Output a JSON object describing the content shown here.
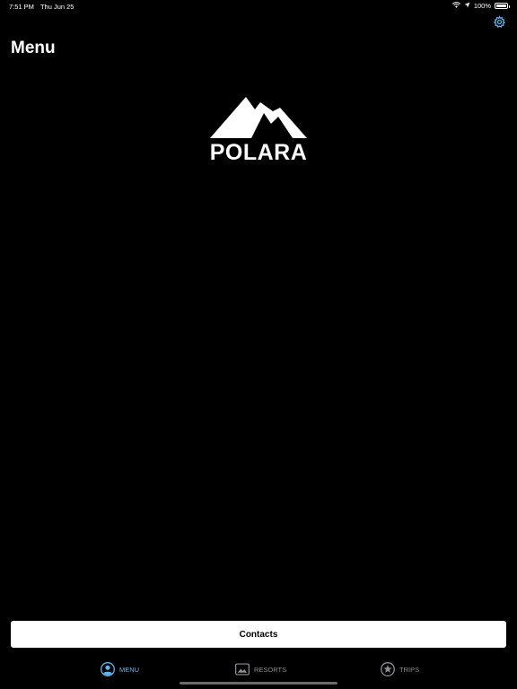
{
  "status_bar": {
    "time": "7:51 PM",
    "date": "Thu Jun 25",
    "battery": "100%",
    "battery_level": 1.0
  },
  "header": {
    "title": "Menu",
    "settings_icon": "gear-icon"
  },
  "logo": {
    "text": "POLARA",
    "icon": "mountain-icon"
  },
  "contacts_button": {
    "label": "Contacts"
  },
  "tab_bar": {
    "active": "menu",
    "tabs": [
      {
        "id": "menu",
        "label": "MENU",
        "icon": "person-circle-icon"
      },
      {
        "id": "resorts",
        "label": "RESORTS",
        "icon": "image-icon"
      },
      {
        "id": "trips",
        "label": "TRIPS",
        "icon": "star-circle-icon"
      }
    ]
  },
  "colors": {
    "background": "#000000",
    "accent": "#5ab8f0",
    "inactive": "#8e8e93",
    "text": "#ffffff",
    "button_bg": "#ffffff",
    "button_text": "#000000"
  }
}
